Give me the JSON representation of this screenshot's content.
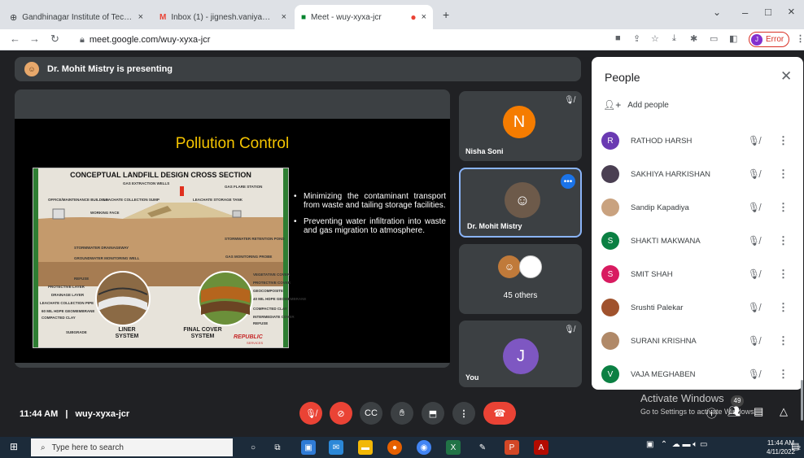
{
  "browser": {
    "tabs": [
      {
        "title": "Gandhinagar Institute of Techno",
        "close": "×"
      },
      {
        "title": "Inbox (1) - jignesh.vaniya@git.o",
        "close": "×"
      },
      {
        "title": "Meet - wuy-xyxa-jcr",
        "close": "×"
      }
    ],
    "new_tab": "+",
    "window": {
      "minimize": "–",
      "maximize": "□",
      "close": "×",
      "chevron": "⌄"
    },
    "url": "meet.google.com/wuy-xyxa-jcr",
    "error_label": "Error",
    "profile_initial": "J"
  },
  "meet": {
    "banner": "Dr. Mohit Mistry is presenting",
    "slide": {
      "title": "Pollution Control",
      "diagram_title": "CONCEPTUAL LANDFILL DESIGN CROSS SECTION",
      "diagram_labels": [
        "GAS EXTRACTION WELLS",
        "GAS FLARE STATION",
        "OFFICE/MAINTENANCE BUILDING",
        "LEACHATE COLLECTION SUMP",
        "LEACHATE STORAGE TANK",
        "WORKING FACE",
        "STORMWATER DRAINAGEWAY",
        "STORMWATER RETENTION POND",
        "GROUNDWATER MONITORING WELL",
        "GAS MONITORING PROBE",
        "REFUSE",
        "PROTECTIVE LAYER",
        "DRAINAGE LAYER",
        "LEACHATE COLLECTION PIPE",
        "60 MIL HDPE GEOMEMBRANE",
        "COMPACTED CLAY",
        "SUBGRADE",
        "VEGETATIVE COVER",
        "PROTECTIVE COVER",
        "GEOCOMPOSITE",
        "40 MIL HDPE GEOMEMBRANE",
        "COMPACTED CLAY",
        "INTERMEDIATE COVER",
        "REFUSE"
      ],
      "liner_system": "LINER SYSTEM",
      "final_cover_system": "FINAL COVER SYSTEM",
      "logo": "REPUBLIC",
      "logo_sub": "SERVICES",
      "bullets": [
        "Minimizing the contaminant transport from waste and tailing storage facilities.",
        "Preventing water infiltration into waste and gas migration to atmosphere."
      ]
    },
    "tiles": [
      {
        "name": "Nisha Soni",
        "initial": "N",
        "color": "#f57c00"
      },
      {
        "name": "Dr. Mohit Mistry"
      },
      {
        "name": "45 others"
      },
      {
        "name": "You",
        "initial": "J",
        "color": "#7e57c2"
      }
    ],
    "people_panel": {
      "title": "People",
      "add_people": "Add people",
      "participants": [
        {
          "name": "RATHOD HARSH",
          "initial": "R",
          "color": "#6a3ab2"
        },
        {
          "name": "SAKHIYA HARKISHAN",
          "initial": "",
          "color": "#4a3f52"
        },
        {
          "name": "Sandip Kapadiya",
          "initial": "",
          "color": "#c9a27f"
        },
        {
          "name": "SHAKTI MAKWANA",
          "initial": "S",
          "color": "#0b8043"
        },
        {
          "name": "SMIT SHAH",
          "initial": "S",
          "color": "#d81b60"
        },
        {
          "name": "Srushti Palekar",
          "initial": "",
          "color": "#a0522d"
        },
        {
          "name": "SURANI KRISHNA",
          "initial": "",
          "color": "#b08968"
        },
        {
          "name": "VAJA MEGHABEN",
          "initial": "V",
          "color": "#0b8043"
        }
      ]
    },
    "footer": {
      "time": "11:44 AM",
      "separator": "|",
      "meeting_code": "wuy-xyxa-jcr"
    },
    "activate_windows": {
      "title": "Activate Windows",
      "subtitle": "Go to Settings to activate Windows."
    },
    "notification_count": "49"
  },
  "taskbar": {
    "search_placeholder": "Type here to search",
    "clock_time": "11:44 AM",
    "clock_date": "4/11/2022",
    "notification_badge": "2"
  }
}
